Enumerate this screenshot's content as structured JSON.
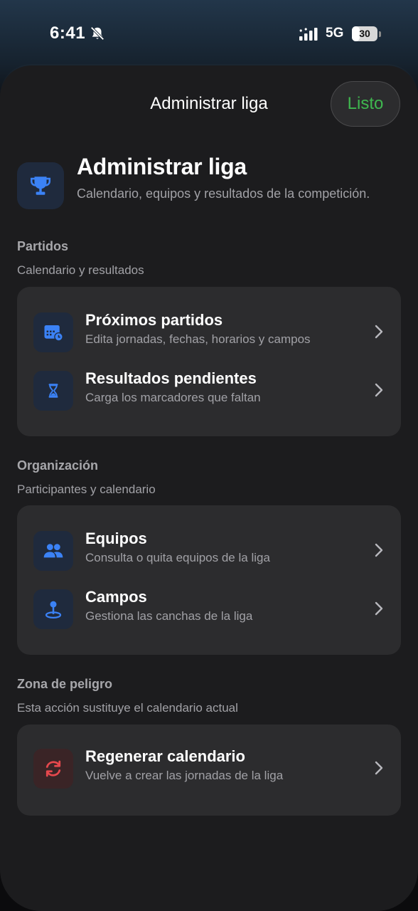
{
  "status_bar": {
    "time": "6:41",
    "network": "5G",
    "battery": "30",
    "battery_level": 0.3
  },
  "nav": {
    "title": "Administrar liga",
    "done_label": "Listo"
  },
  "header": {
    "title": "Administrar liga",
    "subtitle": "Calendario, equipos y resultados de la competición.",
    "icon": "trophy-icon"
  },
  "sections": [
    {
      "title": "Partidos",
      "subtitle": "Calendario y resultados",
      "items": [
        {
          "title": "Próximos partidos",
          "description": "Edita jornadas, fechas, horarios y campos",
          "icon": "calendar-clock-icon"
        },
        {
          "title": "Resultados pendientes",
          "description": "Carga los marcadores que faltan",
          "icon": "hourglass-icon"
        }
      ]
    },
    {
      "title": "Organización",
      "subtitle": "Participantes y calendario",
      "items": [
        {
          "title": "Equipos",
          "description": "Consulta o quita equipos de la liga",
          "icon": "people-icon"
        },
        {
          "title": "Campos",
          "description": "Gestiona las canchas de la liga",
          "icon": "map-pin-icon"
        }
      ]
    },
    {
      "title": "Zona de peligro",
      "subtitle": "Esta acción sustituye el calendario actual",
      "items": [
        {
          "title": "Regenerar calendario",
          "description": "Vuelve a crear las jornadas de la liga",
          "icon": "refresh-icon"
        }
      ]
    }
  ],
  "colors": {
    "accent_blue": "#3b82f6",
    "done_green": "#3fb74f",
    "danger_red": "#e5484d",
    "card": "#2c2c2e",
    "sheet": "#1c1c1e"
  }
}
